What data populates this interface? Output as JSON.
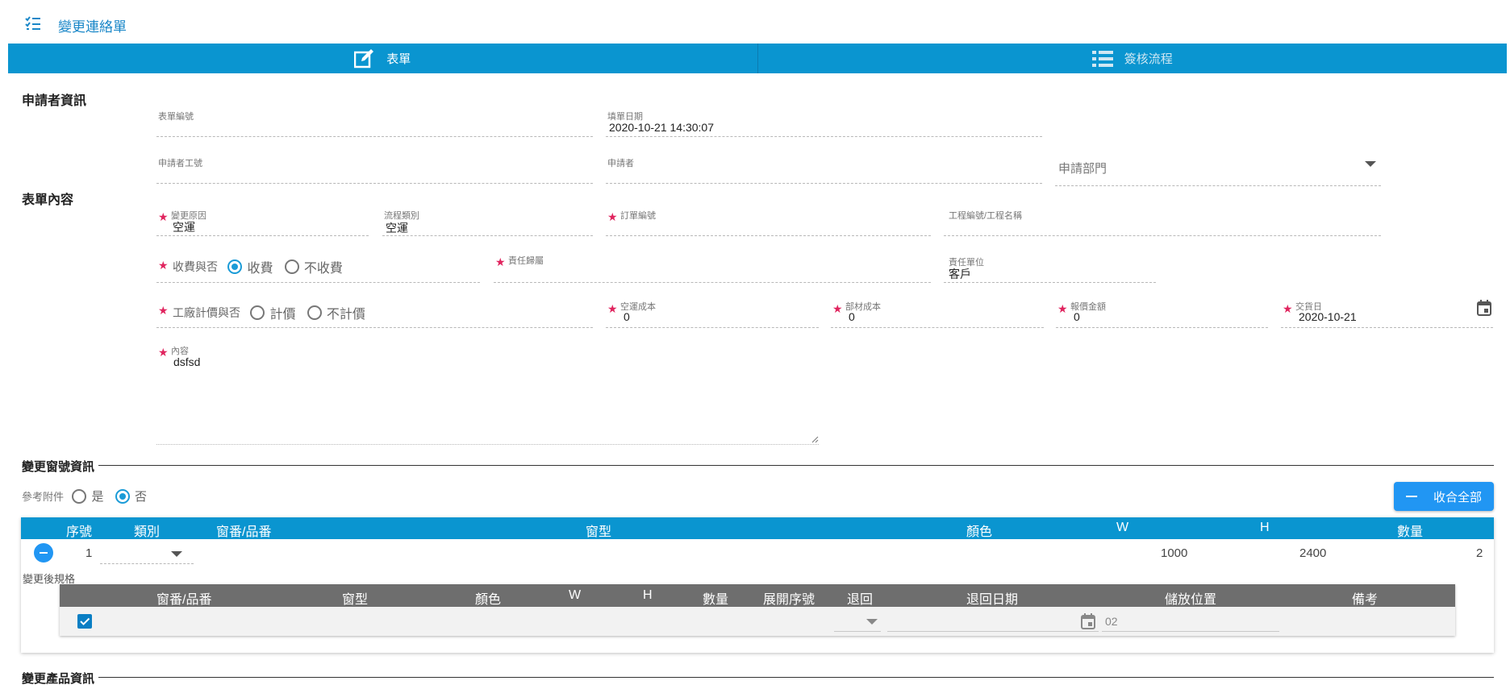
{
  "header": {
    "title": "變更連絡單",
    "menu_icon": "checklist-icon"
  },
  "tabs": [
    {
      "label": "表單",
      "icon": "edit-icon",
      "active": true
    },
    {
      "label": "簽核流程",
      "icon": "list-icon",
      "active": false
    }
  ],
  "applicant": {
    "section_title": "申請者資訊",
    "form_no_label": "表單編號",
    "form_no_value": "",
    "fill_date_label": "填單日期",
    "fill_date_value": "2020-10-21 14:30:07",
    "emp_id_label": "申請者工號",
    "applicant_label": "申請者",
    "dept_placeholder": "申請部門"
  },
  "content": {
    "section_title": "表單內容",
    "reason_label": "變更原因",
    "reason_value": "空運",
    "flow_type_label": "流程類別",
    "flow_type_value": "空運",
    "order_no_label": "訂單編號",
    "project_label": "工程編號/工程名稱",
    "charge_label": "收費與否",
    "charge_options": [
      "收費",
      "不收費"
    ],
    "charge_selected": "收費",
    "resp_unit_label": "責任歸屬",
    "resp_dept_label": "責任單位",
    "resp_dept_value": "客戶",
    "factory_label": "工廠計價與否",
    "factory_options": [
      "計價",
      "不計價"
    ],
    "air_cost_label": "空運成本",
    "air_cost_value": "0",
    "material_cost_label": "部材成本",
    "material_cost_value": "0",
    "quote_label": "報價金額",
    "quote_value": "0",
    "delivery_label": "交貨日",
    "delivery_value": "2020-10-21",
    "desc_label": "內容",
    "desc_value": "dsfsd"
  },
  "window_info": {
    "section_title": "變更窗號資訊",
    "attach_label": "參考附件",
    "attach_options": [
      "是",
      "否"
    ],
    "attach_selected": "否",
    "collapse_all_label": "收合全部",
    "table_headers": [
      "序號",
      "類別",
      "窗番/品番",
      "窗型",
      "顏色",
      "W",
      "H",
      "數量"
    ],
    "rows": [
      {
        "seq": "1",
        "category": "",
        "code": "",
        "type": "",
        "color": "",
        "w": "1000",
        "h": "2400",
        "qty": "2"
      }
    ],
    "after_spec_label": "變更後規格",
    "sub_headers": [
      "窗番/品番",
      "窗型",
      "顏色",
      "W",
      "H",
      "數量",
      "展開序號",
      "退回",
      "退回日期",
      "儲放位置",
      "備考"
    ],
    "sub_row": {
      "checked": true,
      "storage": "02"
    }
  },
  "product_info": {
    "section_title": "變更產品資訊"
  },
  "colors": {
    "primary": "#0a95d0",
    "required": "#e0245e",
    "button": "#2196f3",
    "subhead": "#6e6e6e"
  }
}
